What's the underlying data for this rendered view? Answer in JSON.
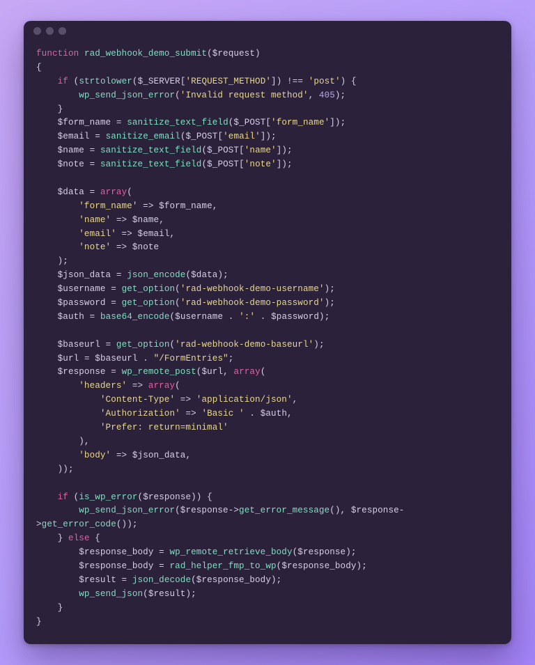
{
  "window": {
    "traffic_lights": [
      "dot1",
      "dot2",
      "dot3"
    ]
  },
  "code": {
    "fn_decl_kw": "function",
    "fn_name": "rad_webhook_demo_submit",
    "fn_param": "$request",
    "brace_open": "{",
    "brace_close": "}",
    "if_kw": "if",
    "else_kw": "else",
    "strtolower": "strtolower",
    "server_var": "$_SERVER",
    "request_method_key": "'REQUEST_METHOD'",
    "neq": "!==",
    "post_str": "'post'",
    "wp_send_json_error": "wp_send_json_error",
    "invalid_method_str": "'Invalid request method'",
    "code_405": "405",
    "form_name_var": "$form_name",
    "sanitize_text_field": "sanitize_text_field",
    "post_var": "$_POST",
    "form_name_key": "'form_name'",
    "email_var": "$email",
    "sanitize_email": "sanitize_email",
    "email_key": "'email'",
    "name_var": "$name",
    "name_key": "'name'",
    "note_var": "$note",
    "note_key": "'note'",
    "data_var": "$data",
    "array_kw": "array",
    "k_form_name": "'form_name'",
    "arrow": "=>",
    "k_name": "'name'",
    "k_email": "'email'",
    "k_note": "'note'",
    "json_data_var": "$json_data",
    "json_encode": "json_encode",
    "username_var": "$username",
    "get_option": "get_option",
    "opt_username": "'rad-webhook-demo-username'",
    "password_var": "$password",
    "opt_password": "'rad-webhook-demo-password'",
    "auth_var": "$auth",
    "base64_encode": "base64_encode",
    "concat_dot": ".",
    "colon_str": "':'",
    "baseurl_var": "$baseurl",
    "opt_baseurl": "'rad-webhook-demo-baseurl'",
    "url_var": "$url",
    "formentries_str": "\"/FormEntries\"",
    "response_var": "$response",
    "wp_remote_post": "wp_remote_post",
    "headers_key": "'headers'",
    "content_type_key": "'Content-Type'",
    "app_json_str": "'application/json'",
    "authorization_key": "'Authorization'",
    "basic_str": "'Basic '",
    "prefer_str": "'Prefer: return=minimal'",
    "body_key": "'body'",
    "is_wp_error": "is_wp_error",
    "get_error_message": "get_error_message",
    "get_error_code": "get_error_code",
    "response_body_var": "$response_body",
    "wp_remote_retrieve_body": "wp_remote_retrieve_body",
    "rad_helper_fmp_to_wp": "rad_helper_fmp_to_wp",
    "result_var": "$result",
    "json_decode": "json_decode",
    "wp_send_json": "wp_send_json"
  }
}
